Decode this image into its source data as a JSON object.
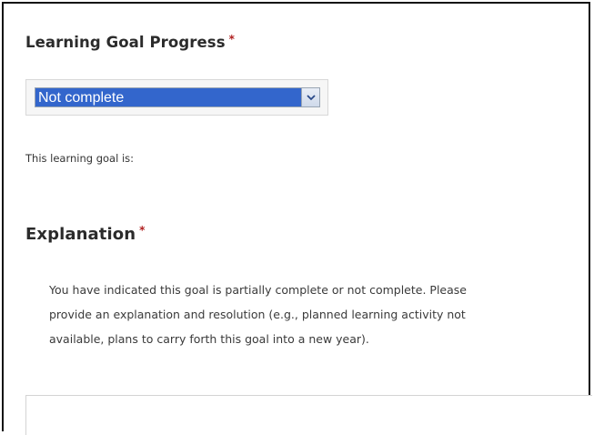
{
  "goal_progress": {
    "heading": "Learning Goal Progress",
    "required_marker": "*",
    "select": {
      "selected_value": "Not complete",
      "arrow_icon": "chevron-down-icon"
    },
    "status_text": "This learning goal is:"
  },
  "explanation": {
    "heading": "Explanation",
    "required_marker": "*",
    "instructions_lines": [
      "You have indicated this goal is partially complete or not complete. Please",
      "provide an explanation and resolution (e.g., planned learning activity not",
      "available, plans to carry forth this goal into a new year)."
    ],
    "textarea_value": ""
  },
  "colors": {
    "select_highlight": "#3366cc",
    "required": "#b02020",
    "frame_border": "#111111"
  }
}
